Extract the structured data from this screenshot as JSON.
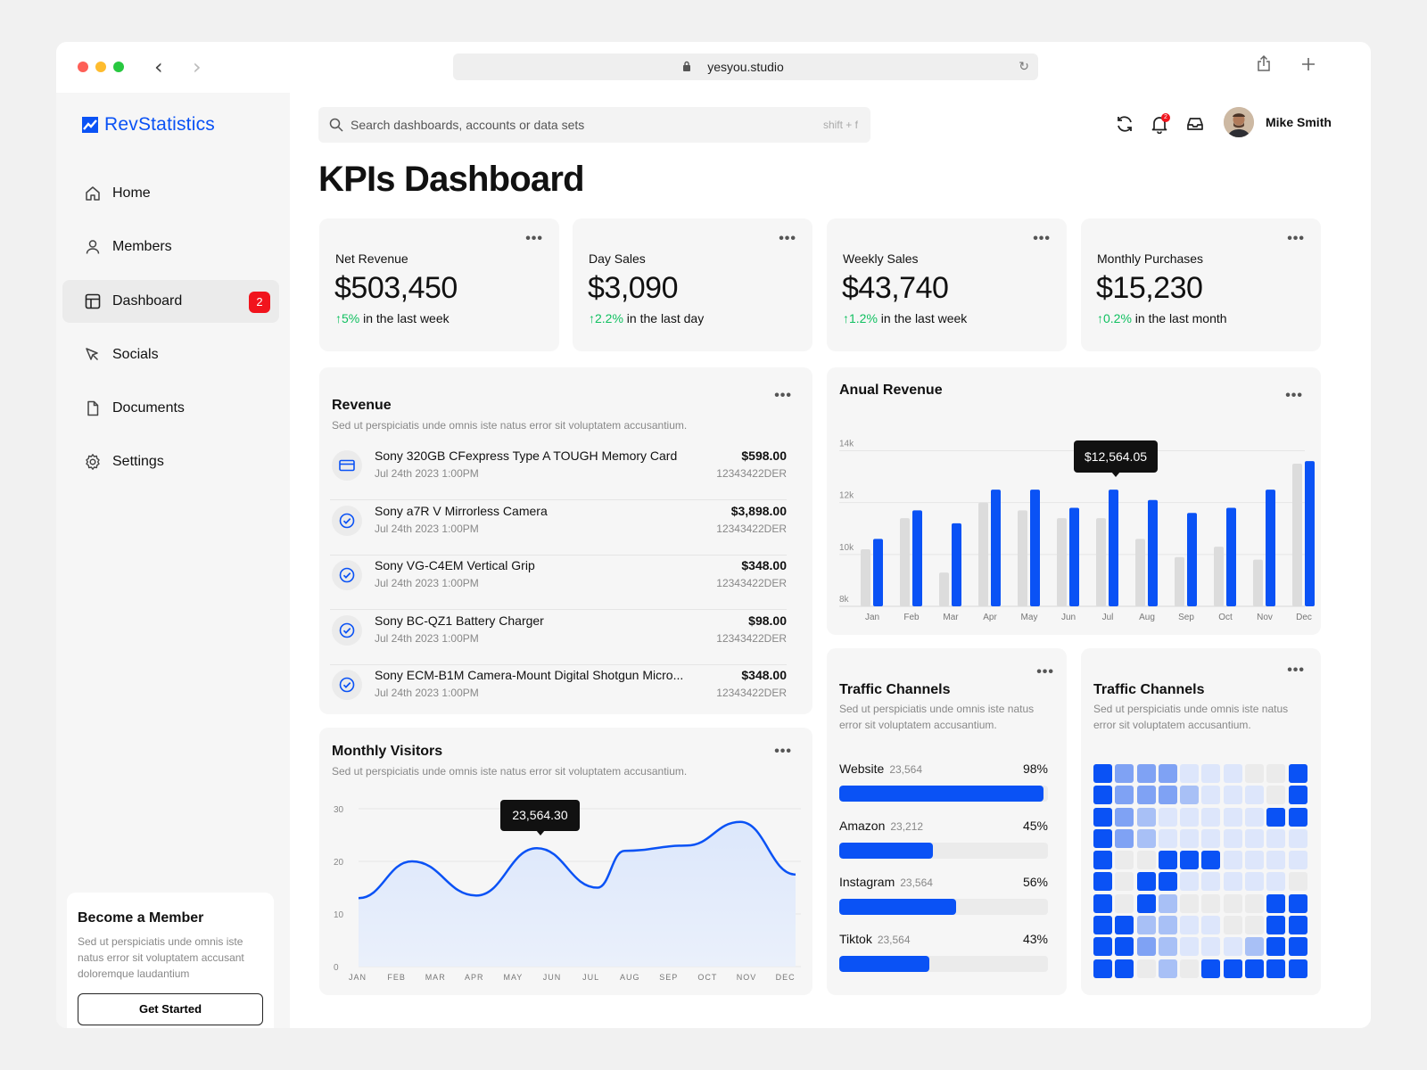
{
  "browser": {
    "url": "yesyou.studio",
    "back_glyph": "‹",
    "forward_glyph": "›",
    "reload_glyph": "↻"
  },
  "app": {
    "name": "RevStatistics",
    "brand_color": "#0a52f5"
  },
  "sidebar": {
    "items": [
      {
        "label": "Home",
        "icon": "home-icon"
      },
      {
        "label": "Members",
        "icon": "user-icon"
      },
      {
        "label": "Dashboard",
        "icon": "dashboard-icon",
        "badge": "2",
        "active": true
      },
      {
        "label": "Socials",
        "icon": "cursor-icon"
      },
      {
        "label": "Documents",
        "icon": "document-icon"
      },
      {
        "label": "Settings",
        "icon": "gear-icon"
      }
    ],
    "member_card": {
      "title": "Become a Member",
      "text": "Sed ut perspiciatis unde omnis iste natus error sit voluptatem accusant doloremque laudantium",
      "button": "Get Started"
    }
  },
  "header": {
    "search_placeholder": "Search dashboards, accounts or data sets",
    "search_shortcut": "shift + f",
    "notification_count": "2",
    "user_name": "Mike Smith"
  },
  "page": {
    "title": "KPIs Dashboard"
  },
  "kpis": [
    {
      "label": "Net Revenue",
      "value": "$503,450",
      "arrow": "↑",
      "change": "5%",
      "period": " in the last week"
    },
    {
      "label": "Day Sales",
      "value": "$3,090",
      "arrow": "↑",
      "change": "2.2%",
      "period": " in the last day"
    },
    {
      "label": "Weekly Sales",
      "value": "$43,740",
      "arrow": "↑",
      "change": "1.2%",
      "period": " in the last week"
    },
    {
      "label": "Monthly Purchases",
      "value": "$15,230",
      "arrow": "↑",
      "change": "0.2%",
      "period": " in the last month"
    }
  ],
  "more_label": "•••",
  "revenue": {
    "title": "Revenue",
    "subtitle": "Sed ut perspiciatis unde omnis iste natus error sit voluptatem accusantium.",
    "rows": [
      {
        "name": "Sony 320GB CFexpress Type A TOUGH Memory Card",
        "date": "Jul 24th 2023 1:00PM",
        "amount": "$598.00",
        "id": "12343422DER",
        "icon": "card-icon"
      },
      {
        "name": "Sony a7R V Mirrorless Camera",
        "date": "Jul 24th 2023 1:00PM",
        "amount": "$3,898.00",
        "id": "12343422DER",
        "icon": "check-circle-icon"
      },
      {
        "name": "Sony VG-C4EM Vertical Grip",
        "date": "Jul 24th 2023 1:00PM",
        "amount": "$348.00",
        "id": "12343422DER",
        "icon": "check-circle-icon"
      },
      {
        "name": "Sony BC-QZ1 Battery Charger",
        "date": "Jul 24th 2023 1:00PM",
        "amount": "$98.00",
        "id": "12343422DER",
        "icon": "check-circle-icon"
      },
      {
        "name": "Sony ECM-B1M Camera-Mount Digital Shotgun Micro...",
        "date": "Jul 24th 2023 1:00PM",
        "amount": "$348.00",
        "id": "12343422DER",
        "icon": "check-circle-icon"
      }
    ]
  },
  "annual": {
    "title": "Anual Revenue",
    "tooltip": "$12,564.05",
    "chart_data": {
      "type": "bar",
      "categories": [
        "Jan",
        "Feb",
        "Mar",
        "Apr",
        "May",
        "Jun",
        "Jul",
        "Aug",
        "Sep",
        "Oct",
        "Nov",
        "Dec"
      ],
      "series": [
        {
          "values": [
            10.2,
            11.4,
            9.3,
            12.0,
            11.7,
            11.4,
            11.4,
            10.6,
            9.9,
            10.3,
            9.8,
            13.5
          ],
          "color": "#dcdcdc"
        },
        {
          "values": [
            10.6,
            11.7,
            11.2,
            12.5,
            12.5,
            11.8,
            12.5,
            12.1,
            11.6,
            11.8,
            12.5,
            13.6
          ],
          "color": "#0a52f5"
        }
      ],
      "y_ticks": [
        "8k",
        "10k",
        "12k",
        "14k"
      ],
      "ylim": [
        8,
        14.6
      ]
    }
  },
  "visitors": {
    "title": "Monthly Visitors",
    "subtitle": "Sed ut perspiciatis unde omnis iste natus error sit voluptatem accusantium.",
    "tooltip": "23,564.30",
    "chart_data": {
      "type": "area",
      "categories": [
        "JAN",
        "FEB",
        "MAR",
        "APR",
        "MAY",
        "JUN",
        "JUL",
        "AUG",
        "SEP",
        "OCT",
        "NOV",
        "DEC"
      ],
      "values": [
        13,
        20,
        13.5,
        22.5,
        15,
        22,
        23,
        27.5,
        17.5
      ],
      "y_ticks": [
        "0",
        "10",
        "20",
        "30"
      ],
      "ylim": [
        0,
        30
      ]
    }
  },
  "traffic1": {
    "title": "Traffic Channels",
    "subtitle": "Sed ut perspiciatis unde omnis iste natus error sit voluptatem accusantium.",
    "channels": [
      {
        "name": "Website",
        "count": "23,564",
        "pct": "98%",
        "value": 98
      },
      {
        "name": "Amazon",
        "count": "23,212",
        "pct": "45%",
        "value": 45
      },
      {
        "name": "Instagram",
        "count": "23,564",
        "pct": "56%",
        "value": 56
      },
      {
        "name": "Tiktok",
        "count": "23,564",
        "pct": "43%",
        "value": 43
      }
    ]
  },
  "traffic2": {
    "title": "Traffic Channels",
    "subtitle": "Sed ut perspiciatis unde omnis iste natus error sit voluptatem accusantium.",
    "heatmap_levels": [
      [
        4,
        3,
        3,
        3,
        1,
        1,
        1,
        0,
        0,
        4
      ],
      [
        4,
        3,
        3,
        3,
        2,
        1,
        1,
        1,
        0,
        4
      ],
      [
        4,
        3,
        2,
        1,
        1,
        1,
        1,
        1,
        4,
        4
      ],
      [
        4,
        3,
        2,
        1,
        1,
        1,
        1,
        1,
        1,
        1
      ],
      [
        4,
        0,
        0,
        4,
        4,
        4,
        1,
        1,
        1,
        1
      ],
      [
        4,
        0,
        4,
        4,
        1,
        1,
        1,
        1,
        1,
        0
      ],
      [
        4,
        0,
        4,
        2,
        0,
        0,
        0,
        0,
        4,
        4
      ],
      [
        4,
        4,
        2,
        2,
        1,
        1,
        0,
        0,
        4,
        4
      ],
      [
        4,
        4,
        3,
        2,
        1,
        1,
        1,
        2,
        4,
        4
      ],
      [
        4,
        4,
        0,
        2,
        0,
        4,
        4,
        4,
        4,
        4
      ]
    ],
    "level_colors": [
      "#ebebeb",
      "#dde6fb",
      "#a8c0f6",
      "#7fa2f4",
      "#0a52f5"
    ]
  }
}
